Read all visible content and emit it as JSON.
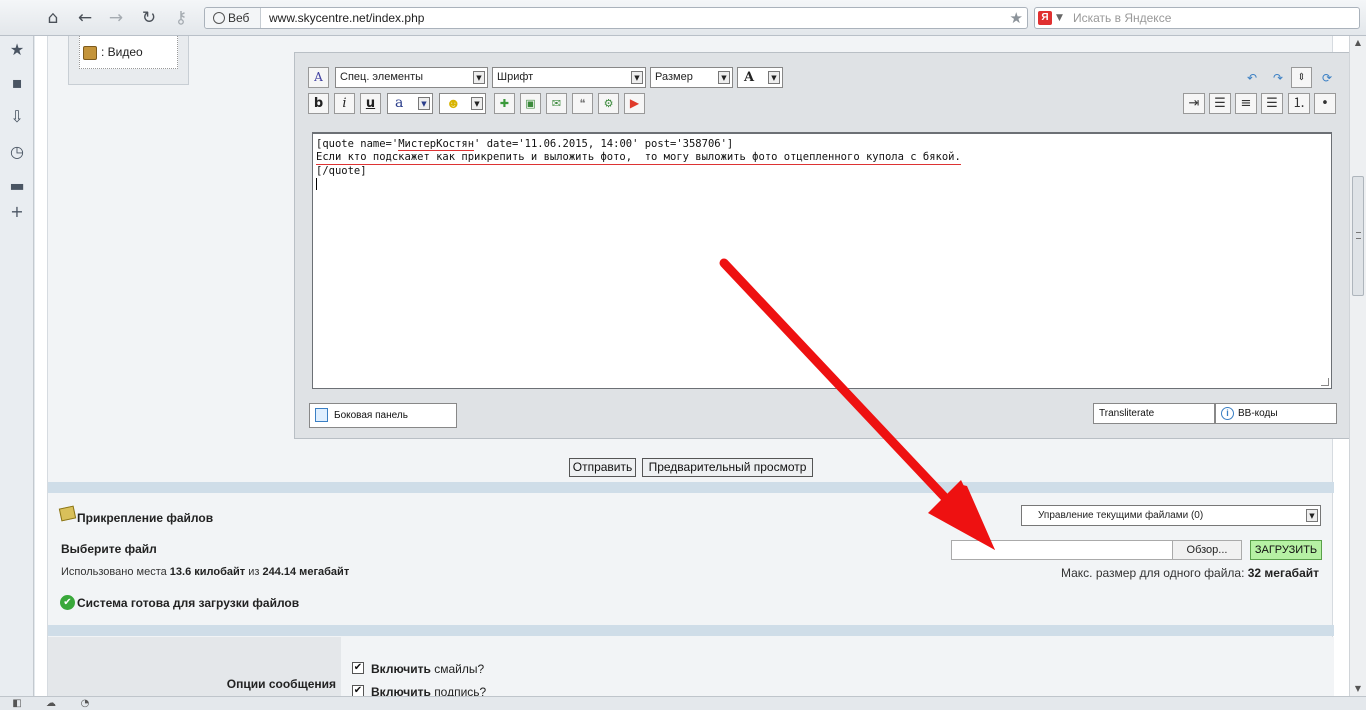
{
  "browser": {
    "web_label": "Веб",
    "url": "www.skycentre.net/index.php",
    "search_placeholder": "Искать в Яндексе",
    "yandex_logo": "Я"
  },
  "side_panel": {
    "video_label": ": Видео"
  },
  "editor": {
    "special_elements": "Спец. элементы",
    "font": "Шрифт",
    "size": "Размер",
    "color_label": "A",
    "bold": "b",
    "italic": "i",
    "underline": "u",
    "format_label": "a",
    "content_line1_a": "[quote name='",
    "content_line1_name": "МистерКостян",
    "content_line1_b": "' date='11.06.2015, 14:00' post='358706']",
    "content_line2": "Если кто подскажет как прикрепить и выложить фото,  то могу выложить фото отцепленного купола с бякой.",
    "content_line3": "[/quote]",
    "side_panel_button": "Боковая панель",
    "transliterate": "Transliterate",
    "bbcodes": "BB-коды"
  },
  "actions": {
    "submit": "Отправить",
    "preview": "Предварительный просмотр"
  },
  "attachments": {
    "title": "Прикрепление файлов",
    "manage_files": "Управление текущими файлами (0)",
    "choose_file": "Выберите файл",
    "browse": "Обзор...",
    "upload": "ЗАГРУЗИТЬ",
    "usage_prefix": "Использовано места",
    "usage_used": "13.6 килобайт",
    "usage_of": "из",
    "usage_total": "244.14 мегабайт",
    "max_size_label": "Макс. размер для одного файла:",
    "max_size_value": "32 мегабайт",
    "ready": "Система готова для загрузки файлов"
  },
  "options": {
    "label": "Опции сообщения",
    "smilies_bold": "Включить",
    "smilies_rest": "смайлы?",
    "signature_bold": "Включить",
    "signature_rest": "подпись?"
  },
  "colors": {
    "arrow": "#ee1111",
    "upload_bg": "#b6f1a4",
    "separator": "#cfdde8"
  }
}
